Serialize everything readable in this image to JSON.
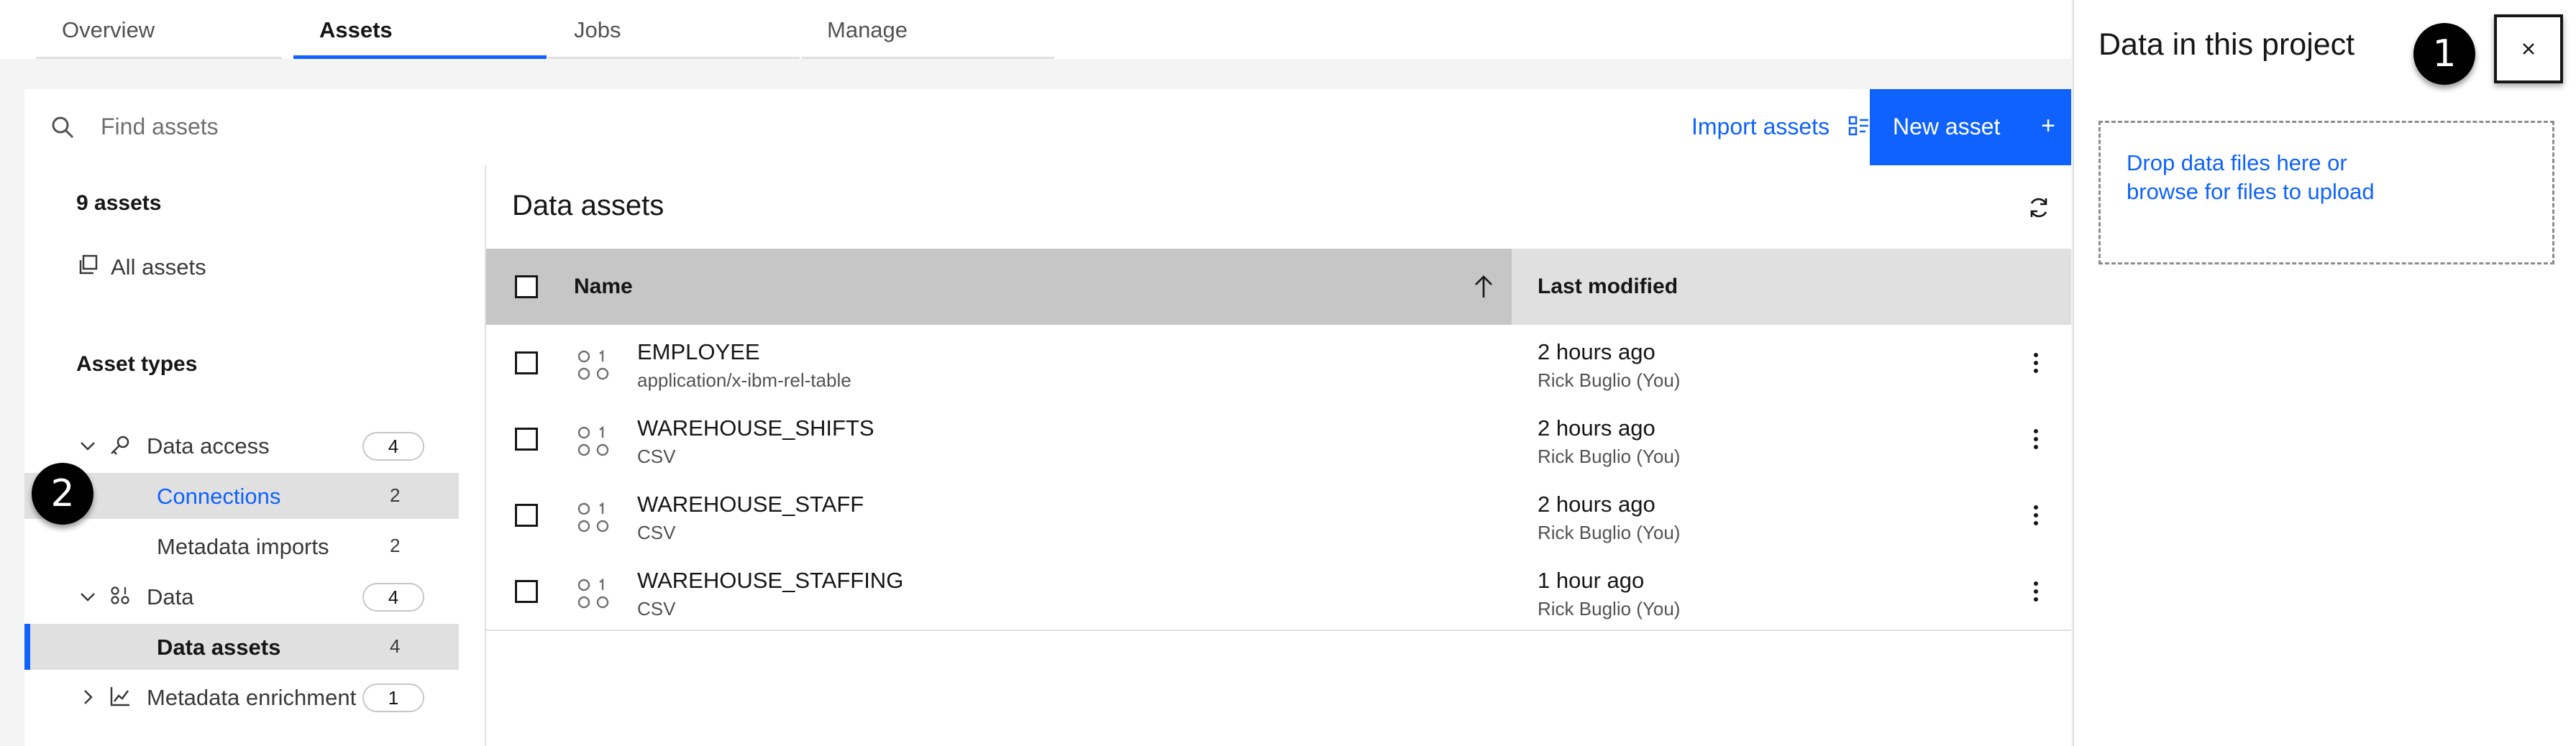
{
  "tabs": [
    {
      "label": "Overview",
      "active": false
    },
    {
      "label": "Assets",
      "active": true
    },
    {
      "label": "Jobs",
      "active": false
    },
    {
      "label": "Manage",
      "active": false
    }
  ],
  "search": {
    "placeholder": "Find assets",
    "icon": "search-icon"
  },
  "toolbar": {
    "import_label": "Import assets",
    "new_label": "New asset",
    "new_plus": "+"
  },
  "sidebar": {
    "count": "9 assets",
    "all_assets": "All assets",
    "asset_types_heading": "Asset types",
    "groups": [
      {
        "label": "Data access",
        "count": "4",
        "icon": "key-icon",
        "expanded": true,
        "items": [
          {
            "label": "Connections",
            "count": "2",
            "selected": false
          },
          {
            "label": "Metadata imports",
            "count": "2",
            "selected": false
          }
        ]
      },
      {
        "label": "Data",
        "count": "4",
        "icon": "data-icon",
        "expanded": true,
        "items": [
          {
            "label": "Data assets",
            "count": "4",
            "selected": true
          }
        ]
      },
      {
        "label": "Metadata enrichment",
        "count": "1",
        "icon": "chart-icon",
        "expanded": false,
        "items": []
      }
    ]
  },
  "main": {
    "title": "Data assets",
    "columns": {
      "name": "Name",
      "modified": "Last modified"
    },
    "rows": [
      {
        "name": "EMPLOYEE",
        "type": "application/x-ibm-rel-table",
        "modified": "2 hours ago",
        "who": "Rick Buglio (You)"
      },
      {
        "name": "WAREHOUSE_SHIFTS",
        "type": "CSV",
        "modified": "2 hours ago",
        "who": "Rick Buglio (You)"
      },
      {
        "name": "WAREHOUSE_STAFF",
        "type": "CSV",
        "modified": "2 hours ago",
        "who": "Rick Buglio (You)"
      },
      {
        "name": "WAREHOUSE_STAFFING",
        "type": "CSV",
        "modified": "1 hour ago",
        "who": "Rick Buglio (You)"
      }
    ]
  },
  "panel": {
    "title": "Data in this project",
    "close_label": "×",
    "drop_line1": "Drop data files here or",
    "drop_line2": "browse for files to upload"
  },
  "callouts": [
    "1",
    "2"
  ],
  "colors": {
    "accent": "#0f62fe",
    "selected_bg": "#e0e0e0",
    "header_bg": "#c6c6c6"
  }
}
